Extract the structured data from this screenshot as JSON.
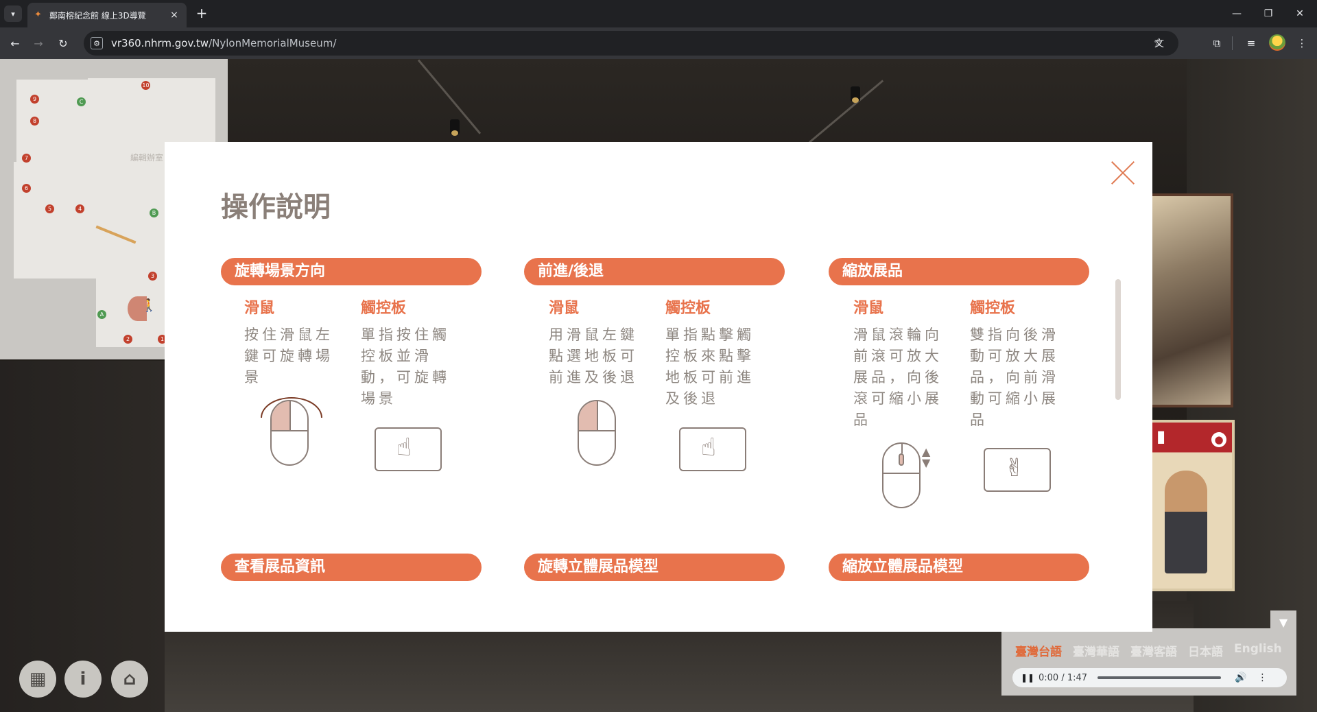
{
  "browser": {
    "tab_title": "鄭南榕紀念館 線上3D導覽",
    "tab_close": "×",
    "new_tab": "+",
    "url_host": "vr360.nhrm.gov.tw",
    "url_path": "/NylonMemorialMuseum/",
    "icons": [
      "tab-search-icon",
      "back-icon",
      "forward-icon",
      "reload-icon",
      "site-info-icon",
      "translate-icon",
      "star-icon",
      "extensions-icon",
      "media-icon",
      "profile-avatar",
      "menu-icon"
    ]
  },
  "minimap": {
    "room_label": "編輯辦室",
    "points_red": [
      "10",
      "9",
      "8",
      "7",
      "6",
      "5",
      "4",
      "3",
      "2",
      "1"
    ],
    "points_green": [
      "C",
      "B",
      "A"
    ]
  },
  "modal": {
    "title": "操作說明",
    "sections": [
      {
        "label": "旋轉場景方向",
        "mouse_head": "滑鼠",
        "mouse_text": "按住滑鼠左鍵可旋轉場景",
        "pad_head": "觸控板",
        "pad_text": "單指按住觸控板並滑動，可旋轉場景"
      },
      {
        "label": "前進/後退",
        "mouse_head": "滑鼠",
        "mouse_text": "用滑鼠左鍵點選地板可前進及後退",
        "pad_head": "觸控板",
        "pad_text": "單指點擊觸控板來點擊地板可前進及後退"
      },
      {
        "label": "縮放展品",
        "mouse_head": "滑鼠",
        "mouse_text": "滑鼠滾輪向前滾可放大展品，向後滾可縮小展品",
        "pad_head": "觸控板",
        "pad_text": "雙指向後滑動可放大展品，向前滑動可縮小展品"
      }
    ],
    "more_sections": [
      "查看展品資訊",
      "旋轉立體展品模型",
      "縮放立體展品模型"
    ]
  },
  "audio": {
    "languages": [
      "臺灣台語",
      "臺灣華語",
      "臺灣客語",
      "日本語",
      "English"
    ],
    "active_language": "臺灣台語",
    "time": "0:00 / 1:47",
    "progress": 0
  },
  "accent_color": "#e8734c"
}
